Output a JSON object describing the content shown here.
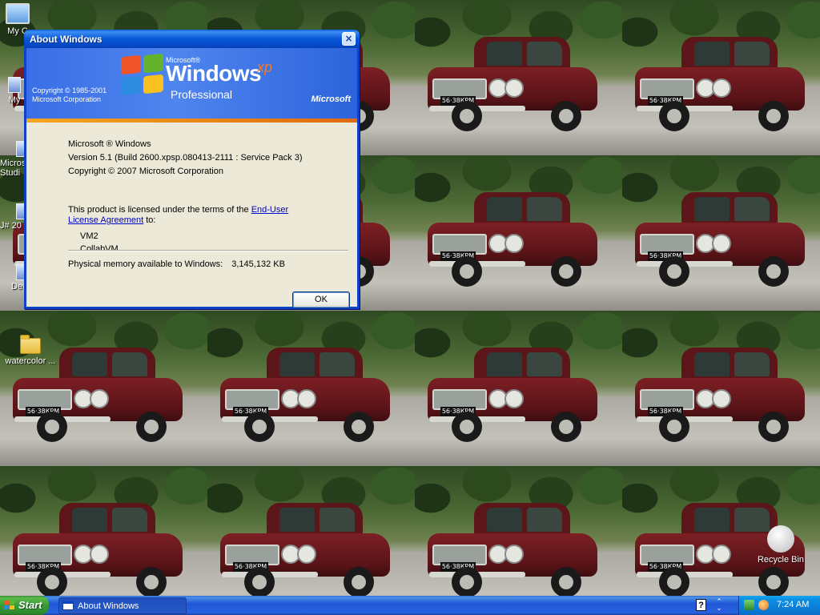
{
  "wallpaper": {
    "plate_text": "56·38КРМ",
    "colors": {
      "car": "#6b1a1f",
      "foliage": "#2f4a22",
      "road": "#b0aea6"
    }
  },
  "desktop": {
    "icons": [
      {
        "id": "my-computer",
        "label": "My C",
        "icon": "computer-icon"
      },
      {
        "id": "partial-my",
        "label": "My",
        "icon": "document-icon"
      },
      {
        "id": "partial-micro",
        "label": "Micros",
        "icon": "application-icon"
      },
      {
        "id": "partial-studio",
        "label": "Studi",
        "icon": "application-icon"
      },
      {
        "id": "partial-20",
        "label": "J# 20",
        "icon": "application-icon"
      },
      {
        "id": "partial-dev",
        "label": "Dev",
        "icon": "application-icon"
      },
      {
        "id": "watercolor",
        "label": "watercolor ...",
        "icon": "folder-icon"
      },
      {
        "id": "recycle-bin",
        "label": "Recycle Bin",
        "icon": "recycle-bin-icon"
      }
    ]
  },
  "dialog": {
    "title": "About Windows",
    "close_label": "×",
    "banner": {
      "microsoft_small": "Microsoft®",
      "windows_word": "Windows",
      "xp_word": "xp",
      "edition": "Professional",
      "copyright_line1": "Copyright © 1985-2001",
      "copyright_line2": "Microsoft Corporation",
      "ms_logo": "Microsoft"
    },
    "product_name": "Microsoft ® Windows",
    "version": "Version 5.1 (Build 2600.xpsp.080413-2111 : Service Pack 3)",
    "copyright": "Copyright © 2007 Microsoft Corporation",
    "license_prefix": "This product is licensed under the terms of the",
    "license_link_line1": "End-User",
    "license_link_line2": "License Agreement",
    "license_suffix": "to:",
    "licensee_name": "VM2",
    "licensee_org": "CollabVM",
    "memory_label": "Physical memory available to Windows:",
    "memory_value": "3,145,132 KB",
    "ok_label": "OK"
  },
  "taskbar": {
    "start_label": "Start",
    "buttons": [
      {
        "label": "About Windows",
        "icon": "window-icon"
      }
    ],
    "tray": {
      "clock": "7:24 AM",
      "icons": [
        "network-icon",
        "search-icon"
      ]
    },
    "help_icon": "?",
    "colors": {
      "taskbar": "#2157d7",
      "start": "#389a35",
      "tray": "#0b7fd8"
    }
  }
}
